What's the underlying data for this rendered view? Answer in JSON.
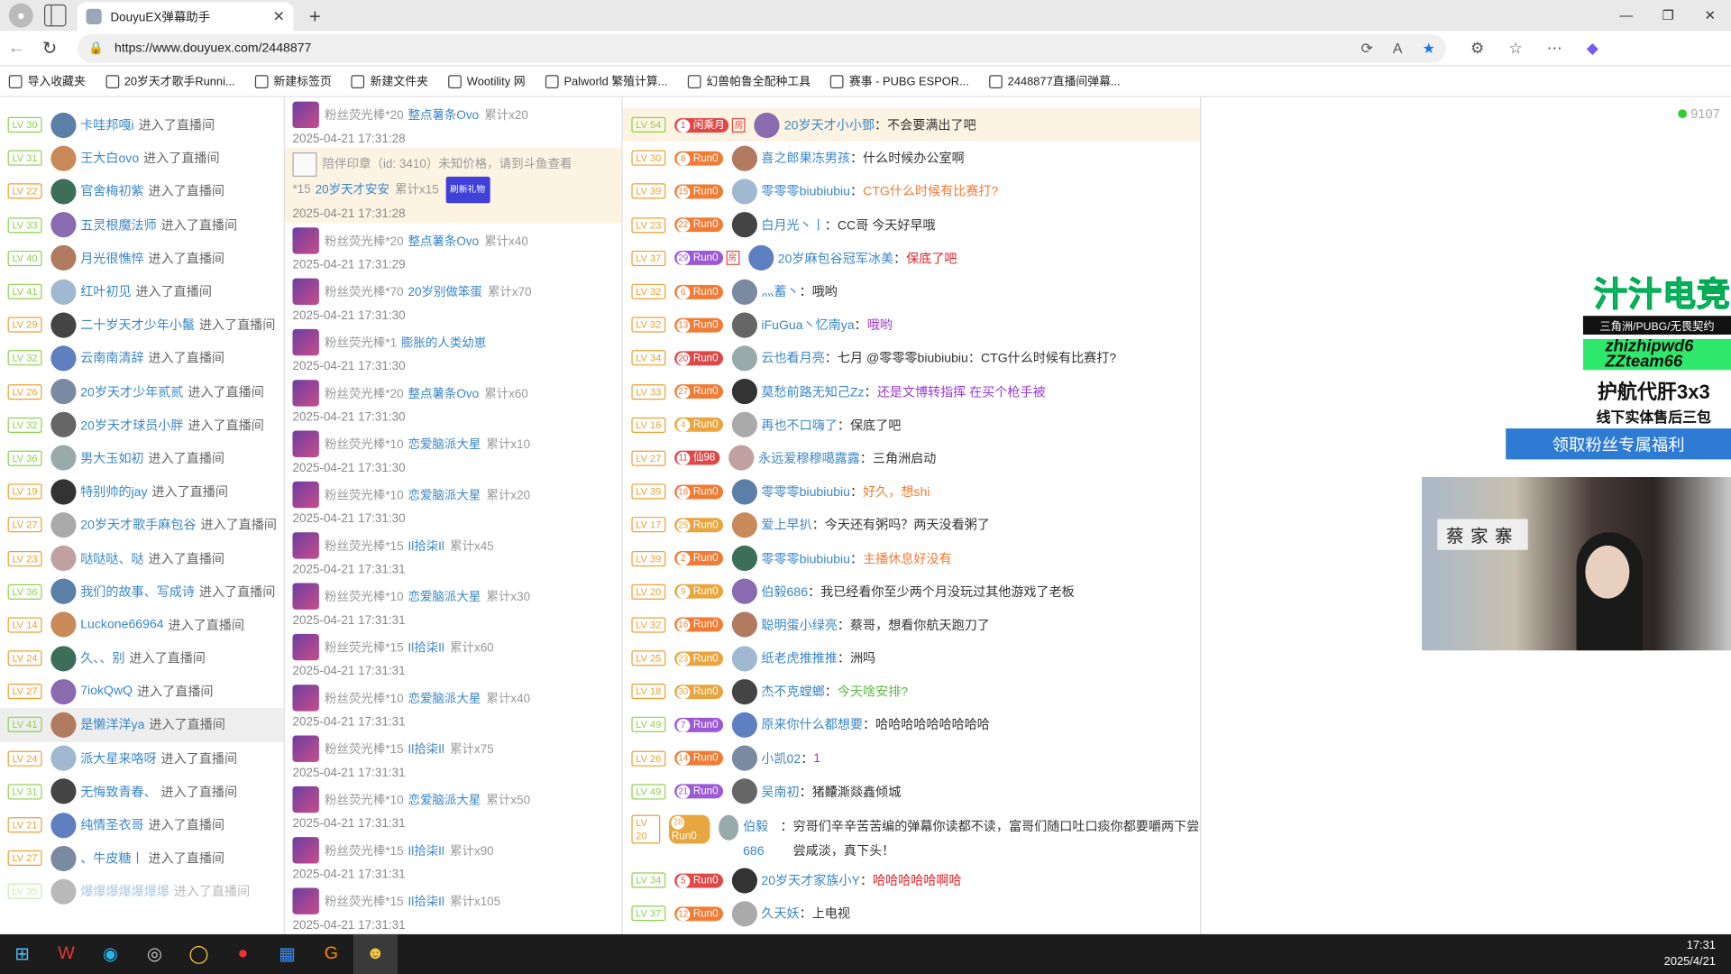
{
  "browser": {
    "tab_title": "DouyuEX弹幕助手",
    "url": "https://www.douyuex.com/2448877",
    "bookmarks": [
      "导入收藏夹",
      "20岁天才歌手Runni...",
      "新建标签页",
      "新建文件夹",
      "Wootility 网",
      "Palworld 繁殖计算...",
      "幻兽帕鲁全配种工具",
      "赛事 - PUBG ESPOR...",
      "2448877直播间弹幕..."
    ]
  },
  "entries": [
    {
      "lv": "LV 30",
      "c": "lvg",
      "name": "卡哇邦嘎i",
      "action": "进入了直播间"
    },
    {
      "lv": "LV 31",
      "c": "lvg",
      "name": "王大白ovo",
      "action": "进入了直播间"
    },
    {
      "lv": "LV 22",
      "c": "lvo",
      "name": "官舍梅初紫",
      "action": "进入了直播间"
    },
    {
      "lv": "LV 33",
      "c": "lvg",
      "name": "五灵根魔法师",
      "action": "进入了直播间"
    },
    {
      "lv": "LV 40",
      "c": "lvg",
      "name": "月光很憔悴",
      "action": "进入了直播间"
    },
    {
      "lv": "LV 41",
      "c": "lvg",
      "name": "红叶初见",
      "action": "进入了直播间"
    },
    {
      "lv": "LV 29",
      "c": "lvo",
      "name": "二十岁天才少年小鬣",
      "action": "进入了直播间"
    },
    {
      "lv": "LV 32",
      "c": "lvg",
      "name": "云南南清辞",
      "action": "进入了直播间"
    },
    {
      "lv": "LV 26",
      "c": "lvo",
      "name": "20岁天才少年贰贰",
      "action": "进入了直播间"
    },
    {
      "lv": "LV 32",
      "c": "lvg",
      "name": "20岁天才球员小胖",
      "action": "进入了直播间"
    },
    {
      "lv": "LV 36",
      "c": "lvg",
      "name": "男大玉如初",
      "action": "进入了直播间"
    },
    {
      "lv": "LV 19",
      "c": "lvo",
      "name": "特别帅的jay",
      "action": "进入了直播间"
    },
    {
      "lv": "LV 27",
      "c": "lvo",
      "name": "20岁天才歌手麻包谷",
      "action": "进入了直播间"
    },
    {
      "lv": "LV 23",
      "c": "lvo",
      "name": "哒哒哒、哒",
      "action": "进入了直播间"
    },
    {
      "lv": "LV 36",
      "c": "lvg",
      "name": "我们的故事、写成诗",
      "action": "进入了直播间"
    },
    {
      "lv": "LV 14",
      "c": "lvo",
      "name": "Luckone66964",
      "action": "进入了直播间"
    },
    {
      "lv": "LV 24",
      "c": "lvo",
      "name": "久、、别",
      "action": "进入了直播间"
    },
    {
      "lv": "LV 27",
      "c": "lvo",
      "name": "7iokQwQ",
      "action": "进入了直播间"
    },
    {
      "lv": "LV 41",
      "c": "lvg",
      "name": "是懒洋洋ya",
      "action": "进入了直播间",
      "hl": true
    },
    {
      "lv": "LV 24",
      "c": "lvo",
      "name": "派大星来咯呀",
      "action": "进入了直播间"
    },
    {
      "lv": "LV 31",
      "c": "lvg",
      "name": "无悔致青春、",
      "action": "进入了直播间"
    },
    {
      "lv": "LV 21",
      "c": "lvo",
      "name": "纯情圣衣哥",
      "action": "进入了直播间"
    },
    {
      "lv": "LV 27",
      "c": "lvo",
      "name": "、牛皮糖丨",
      "action": "进入了直播间"
    },
    {
      "lv": "LV 35",
      "c": "lvg",
      "name": "爆爆爆爆爆爆爆",
      "action": "进入了直播间"
    }
  ],
  "gifts": [
    {
      "gift": "粉丝荧光棒*20",
      "user": "整点薯条Ovo",
      "cum": "累计x20",
      "time": "2025-04-21 17:31:28"
    },
    {
      "special": true,
      "text": "陪伴印章（id: 3410）未知价格，请到斗鱼查看",
      "count": "*15",
      "user": "20岁天才安安",
      "cum": "累计x15",
      "btn": "刷新礼物",
      "time": "2025-04-21 17:31:28"
    },
    {
      "gift": "粉丝荧光棒*20",
      "user": "整点薯条Ovo",
      "cum": "累计x40",
      "time": "2025-04-21 17:31:29"
    },
    {
      "gift": "粉丝荧光棒*70",
      "user": "20岁别做笨蛋",
      "cum": "累计x70",
      "time": "2025-04-21 17:31:30"
    },
    {
      "gift": "粉丝荧光棒*1",
      "user": "膨胀的人类幼崽",
      "cum": "",
      "time": "2025-04-21 17:31:30"
    },
    {
      "gift": "粉丝荧光棒*20",
      "user": "整点薯条Ovo",
      "cum": "累计x60",
      "time": "2025-04-21 17:31:30"
    },
    {
      "gift": "粉丝荧光棒*10",
      "user": "恋爱脑派大星",
      "cum": "累计x10",
      "time": "2025-04-21 17:31:30"
    },
    {
      "gift": "粉丝荧光棒*10",
      "user": "恋爱脑派大星",
      "cum": "累计x20",
      "time": "2025-04-21 17:31:30"
    },
    {
      "gift": "粉丝荧光棒*15",
      "user": "Il拾柒Il",
      "cum": "累计x45",
      "time": "2025-04-21 17:31:31"
    },
    {
      "gift": "粉丝荧光棒*10",
      "user": "恋爱脑派大星",
      "cum": "累计x30",
      "time": "2025-04-21 17:31:31"
    },
    {
      "gift": "粉丝荧光棒*15",
      "user": "Il拾柒Il",
      "cum": "累计x60",
      "time": "2025-04-21 17:31:31"
    },
    {
      "gift": "粉丝荧光棒*10",
      "user": "恋爱脑派大星",
      "cum": "累计x40",
      "time": "2025-04-21 17:31:31"
    },
    {
      "gift": "粉丝荧光棒*15",
      "user": "Il拾柒Il",
      "cum": "累计x75",
      "time": "2025-04-21 17:31:31"
    },
    {
      "gift": "粉丝荧光棒*10",
      "user": "恋爱脑派大星",
      "cum": "累计x50",
      "time": "2025-04-21 17:31:31"
    },
    {
      "gift": "粉丝荧光棒*15",
      "user": "Il拾柒Il",
      "cum": "累计x90",
      "time": "2025-04-21 17:31:31"
    },
    {
      "gift": "粉丝荧光棒*15",
      "user": "Il拾柒Il",
      "cum": "累计x105",
      "time": "2025-04-21 17:31:31"
    }
  ],
  "chat": [
    {
      "lv": "LV 54",
      "c": "lvg",
      "badge": "闲乘月",
      "bc": "red",
      "fang": true,
      "user": "20岁天才小小鄧",
      "msg": "不会要满出了吧",
      "mc": "",
      "hl": true
    },
    {
      "lv": "LV 30",
      "c": "lvo",
      "badge": "Run0",
      "bc": "",
      "user": "喜之郎果冻男孩",
      "msg": "什么时候办公室啊",
      "mc": ""
    },
    {
      "lv": "LV 39",
      "c": "lvo",
      "badge": "Run0",
      "bc": "",
      "user": "零零零biubiubiu",
      "msg": "CTG什么时候有比赛打?",
      "mc": "orange"
    },
    {
      "lv": "LV 23",
      "c": "lvo",
      "badge": "Run0",
      "bc": "",
      "user": "白月光丶丨",
      "msg": "CC哥 今天好早哦",
      "mc": ""
    },
    {
      "lv": "LV 37",
      "c": "lvo",
      "badge": "Run0",
      "bc": "purple",
      "fang": true,
      "user": "20岁麻包谷冠军冰美",
      "msg": "保底了吧",
      "mc": "red"
    },
    {
      "lv": "LV 32",
      "c": "lvo",
      "badge": "Run0",
      "bc": "",
      "user": "灬蓄丶",
      "msg": "哦哟",
      "mc": ""
    },
    {
      "lv": "LV 32",
      "c": "lvo",
      "badge": "Run0",
      "bc": "",
      "user": "iFuGua丶忆南ya",
      "msg": "哦哟",
      "mc": "purple"
    },
    {
      "lv": "LV 34",
      "c": "lvo",
      "badge": "Run0",
      "bc": "red",
      "user": "云也看月亮",
      "msg": "七月 @零零零biubiubiu：CTG什么时候有比赛打?",
      "mc": ""
    },
    {
      "lv": "LV 33",
      "c": "lvo",
      "badge": "Run0",
      "bc": "",
      "user": "莫愁前路无知己Zz",
      "msg": "还是文博转指挥 在买个枪手被",
      "mc": "purple"
    },
    {
      "lv": "LV 16",
      "c": "lvo",
      "badge": "Run0",
      "bc": "gold",
      "user": "再也不口嗨了",
      "msg": "保底了吧",
      "mc": ""
    },
    {
      "lv": "LV 27",
      "c": "lvo",
      "badge": "仙98",
      "bc": "red",
      "user": "永远爱穆穆噶露露",
      "msg": "三角洲启动",
      "mc": ""
    },
    {
      "lv": "LV 39",
      "c": "lvo",
      "badge": "Run0",
      "bc": "",
      "user": "零零零biubiubiu",
      "msg": "好久，想shi",
      "mc": "orange"
    },
    {
      "lv": "LV 17",
      "c": "lvo",
      "badge": "Run0",
      "bc": "gold",
      "user": "爱上早扒",
      "msg": "今天还有粥吗？两天没看粥了",
      "mc": ""
    },
    {
      "lv": "LV 39",
      "c": "lvo",
      "badge": "Run0",
      "bc": "",
      "user": "零零零biubiubiu",
      "msg": "主播休息好没有",
      "mc": "orange"
    },
    {
      "lv": "LV 20",
      "c": "lvo",
      "badge": "Run0",
      "bc": "gold",
      "user": "伯毅686",
      "msg": "我已经看你至少两个月没玩过其他游戏了老板",
      "mc": ""
    },
    {
      "lv": "LV 32",
      "c": "lvo",
      "badge": "Run0",
      "bc": "",
      "user": "聪明蛋小绿亮",
      "msg": "蔡哥，想看你航天跑刀了",
      "mc": ""
    },
    {
      "lv": "LV 25",
      "c": "lvo",
      "badge": "Run0",
      "bc": "gold",
      "user": "纸老虎推推推",
      "msg": "洲吗",
      "mc": ""
    },
    {
      "lv": "LV 18",
      "c": "lvo",
      "badge": "Run0",
      "bc": "gold",
      "user": "杰不克螳螂",
      "msg": "今天啥安排?",
      "mc": "green"
    },
    {
      "lv": "LV 49",
      "c": "lvg",
      "badge": "Run0",
      "bc": "purple",
      "user": "原来你什么都想要",
      "msg": "哈哈哈哈哈哈哈哈哈",
      "mc": ""
    },
    {
      "lv": "LV 26",
      "c": "lvo",
      "badge": "Run0",
      "bc": "",
      "user": "小凯02",
      "msg": "1",
      "mc": "purple"
    },
    {
      "lv": "LV 49",
      "c": "lvg",
      "badge": "Run0",
      "bc": "purple",
      "user": "吴南初",
      "msg": "猪齉澌燚鑫倾城",
      "mc": ""
    },
    {
      "lv": "LV 20",
      "c": "lvo",
      "badge": "Run0",
      "bc": "gold",
      "user": "伯毅686",
      "msg": "穷哥们辛辛苦苦编的弹幕你读都不读，富哥们随口吐口痰你都要嚼两下尝尝咸淡，真下头！",
      "mc": "",
      "tall": true
    },
    {
      "lv": "LV 34",
      "c": "lvg",
      "badge": "Run0",
      "bc": "red",
      "user": "20岁天才家族小Y",
      "msg": "哈哈哈哈哈啊哈",
      "mc": "red"
    },
    {
      "lv": "LV 37",
      "c": "lvg",
      "badge": "Run0",
      "bc": "",
      "user": "久天妖",
      "msg": "上电视",
      "mc": "cu"
    }
  ],
  "side": {
    "online": "9107",
    "ad_title": "汁汁电竞",
    "ad_sub": "三角洲/PUBG/无畏契约",
    "ad_wechat": "zhizhipwd6 ZZteam66",
    "ad_line1": "护航代肝3x3",
    "ad_line2": "线下实体售后三包",
    "fan_button": "领取粉丝专属福利",
    "video_sign": "蔡家寨"
  },
  "taskbar": {
    "time": "17:31",
    "date": "2025/4/21"
  }
}
